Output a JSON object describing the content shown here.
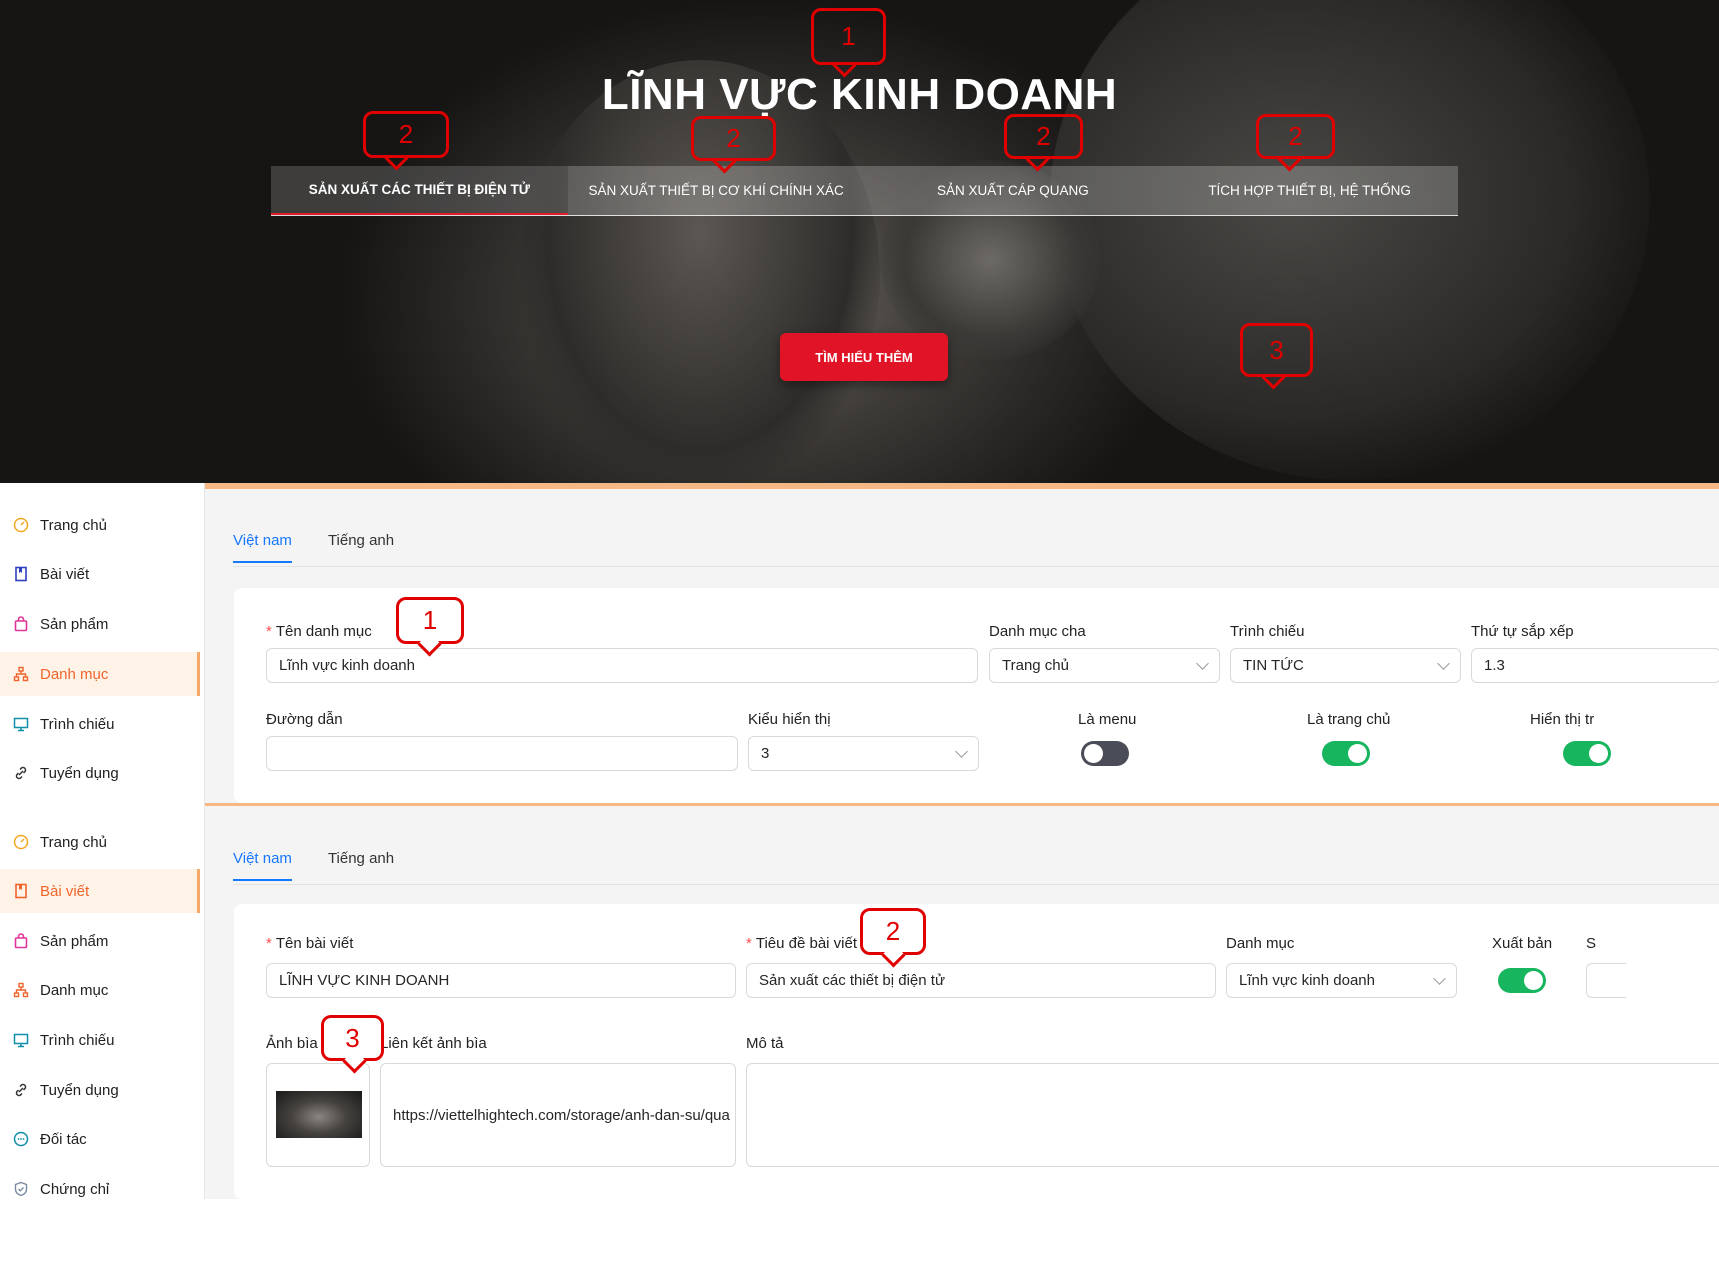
{
  "hero": {
    "title": "LĨNH VỰC KINH DOANH",
    "tabs": [
      {
        "label": "SẢN XUẤT CÁC THIẾT BỊ ĐIỆN TỬ"
      },
      {
        "label": "SẢN XUẤT THIẾT BỊ CƠ KHÍ CHÍNH XÁC"
      },
      {
        "label": "SẢN XUẤT CÁP QUANG"
      },
      {
        "label": "TÍCH HỢP THIẾT BỊ, HỆ THỐNG"
      }
    ],
    "cta": "TÌM HIỂU THÊM"
  },
  "callouts": {
    "one": "1",
    "two": "2",
    "three": "3"
  },
  "sidebar1": {
    "items": [
      {
        "label": "Trang chủ",
        "icon": "dashboard-icon"
      },
      {
        "label": "Bài viết",
        "icon": "book-icon"
      },
      {
        "label": "Sản phẩm",
        "icon": "shopping-bag-icon"
      },
      {
        "label": "Danh mục",
        "icon": "hierarchy-icon"
      },
      {
        "label": "Trình chiếu",
        "icon": "monitor-icon"
      },
      {
        "label": "Tuyển dụng",
        "icon": "link-icon"
      }
    ]
  },
  "sidebar2": {
    "items": [
      {
        "label": "Trang chủ",
        "icon": "dashboard-icon"
      },
      {
        "label": "Bài viết",
        "icon": "book-icon"
      },
      {
        "label": "Sản phẩm",
        "icon": "shopping-bag-icon"
      },
      {
        "label": "Danh mục",
        "icon": "hierarchy-icon"
      },
      {
        "label": "Trình chiếu",
        "icon": "monitor-icon"
      },
      {
        "label": "Tuyển dụng",
        "icon": "link-icon"
      },
      {
        "label": "Đối tác",
        "icon": "chat-icon"
      },
      {
        "label": "Chứng chỉ",
        "icon": "shield-icon"
      }
    ]
  },
  "tabs": {
    "vi": "Việt nam",
    "en": "Tiếng anh"
  },
  "category_form": {
    "name_label": "Tên danh mục",
    "name_value": "Lĩnh vực kinh doanh",
    "parent_label": "Danh mục cha",
    "parent_value": "Trang chủ",
    "slideshow_label": "Trình chiếu",
    "slideshow_value": "TIN TỨC",
    "order_label": "Thứ tự sắp xếp",
    "order_value": "1.3",
    "path_label": "Đường dẫn",
    "path_value": "",
    "display_label": "Kiểu hiển thị",
    "display_value": "3",
    "is_menu_label": "Là menu",
    "is_menu": false,
    "is_home_label": "Là trang chủ",
    "is_home": true,
    "show_label": "Hiển thị tr",
    "show": true
  },
  "post_form": {
    "name_label": "Tên bài viết",
    "name_value": "LĨNH VỰC KINH DOANH",
    "title_label": "Tiêu đề bài viết",
    "title_value": "Sản xuất các thiết bị điện tử",
    "category_label": "Danh mục",
    "category_value": "Lĩnh vực kinh doanh",
    "publish_label": "Xuất bản",
    "publish": true,
    "cut_label": "S",
    "cover_label": "Ảnh bìa",
    "cover_link_label": "Liên kết ảnh bìa",
    "cover_link_value": "https://viettelhightech.com/storage/anh-dan-su/qua",
    "desc_label": "Mô tả"
  },
  "colors": {
    "accent_red": "#e01426",
    "active_orange": "#f0642a",
    "tab_blue": "#1677ff",
    "toggle_green": "#16b55e",
    "callout_red": "#e00000"
  }
}
